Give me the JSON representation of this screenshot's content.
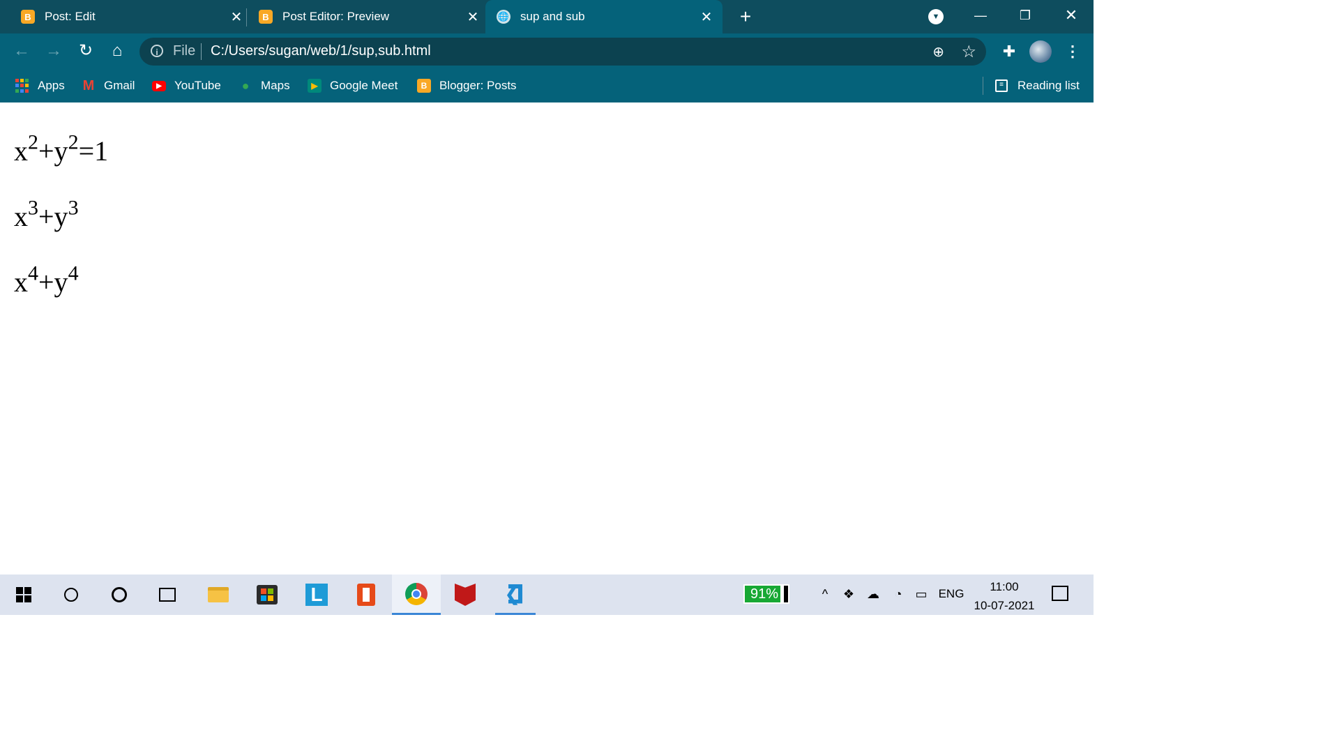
{
  "tabs": [
    {
      "label": "Post: Edit",
      "icon": "blogger-icon"
    },
    {
      "label": "Post Editor: Preview",
      "icon": "blogger-icon"
    },
    {
      "label": "sup and sub",
      "icon": "globe-icon"
    }
  ],
  "toolbar": {
    "scheme_label": "File",
    "url": "C:/Users/sugan/web/1/sup,sub.html"
  },
  "bookmarks": [
    {
      "label": "Apps",
      "icon": "apps-grid-icon"
    },
    {
      "label": "Gmail",
      "icon": "gmail-icon"
    },
    {
      "label": "YouTube",
      "icon": "youtube-icon"
    },
    {
      "label": "Maps",
      "icon": "maps-icon"
    },
    {
      "label": "Google Meet",
      "icon": "meet-icon"
    },
    {
      "label": "Blogger: Posts",
      "icon": "blogger-icon"
    }
  ],
  "reading_list": "Reading list",
  "content": {
    "equations": [
      {
        "parts": [
          "x",
          "2",
          "+y",
          "2",
          "=1"
        ]
      },
      {
        "parts": [
          "x",
          "3",
          "+y",
          "3",
          ""
        ]
      },
      {
        "parts": [
          "x",
          "4",
          "+y",
          "4",
          ""
        ]
      }
    ]
  },
  "taskbar": {
    "battery_percent": "91%",
    "battery_level": 0.91,
    "language": "ENG",
    "time": "11:00",
    "date": "10-07-2021"
  },
  "colors": {
    "chrome_frame": "#0e4d5e",
    "toolbar": "#05627a",
    "taskbar": "#dde3ef",
    "battery_green": "#18a834"
  }
}
